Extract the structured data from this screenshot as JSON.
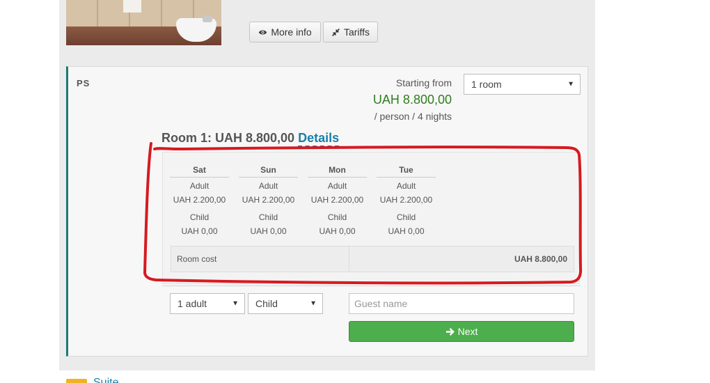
{
  "colors": {
    "accent": "#1a7a78",
    "price": "#2e7d1f",
    "link": "#1a7fa8",
    "next": "#4cae4c",
    "annotation": "#d71920"
  },
  "top_buttons": {
    "more_info": {
      "label": "More info",
      "icon": "eye-icon"
    },
    "tariffs": {
      "label": "Tariffs",
      "icon": "compress-icon"
    }
  },
  "room": {
    "code": "PS",
    "starting_from": "Starting from",
    "price": "UAH 8.800,00",
    "per": "/ person / 4 nights",
    "rooms_select": "1 room",
    "total_label": "Room 1: UAH 8.800,00",
    "details_link": "Details"
  },
  "breakdown": {
    "days": [
      {
        "day": "Sat",
        "adult_label": "Adult",
        "adult_price": "UAH 2.200,00",
        "child_label": "Child",
        "child_price": "UAH 0,00"
      },
      {
        "day": "Sun",
        "adult_label": "Adult",
        "adult_price": "UAH 2.200,00",
        "child_label": "Child",
        "child_price": "UAH 0,00"
      },
      {
        "day": "Mon",
        "adult_label": "Adult",
        "adult_price": "UAH 2.200,00",
        "child_label": "Child",
        "child_price": "UAH 0,00"
      },
      {
        "day": "Tue",
        "adult_label": "Adult",
        "adult_price": "UAH 2.200,00",
        "child_label": "Child",
        "child_price": "UAH 0,00"
      }
    ],
    "room_cost_label": "Room cost",
    "room_cost_value": "UAH 8.800,00"
  },
  "form": {
    "adults": "1 adult",
    "child": "Child",
    "guest_placeholder": "Guest name",
    "next_label": "Next",
    "next_icon": "arrow-right-icon"
  },
  "next_item": {
    "link": "Suite"
  }
}
